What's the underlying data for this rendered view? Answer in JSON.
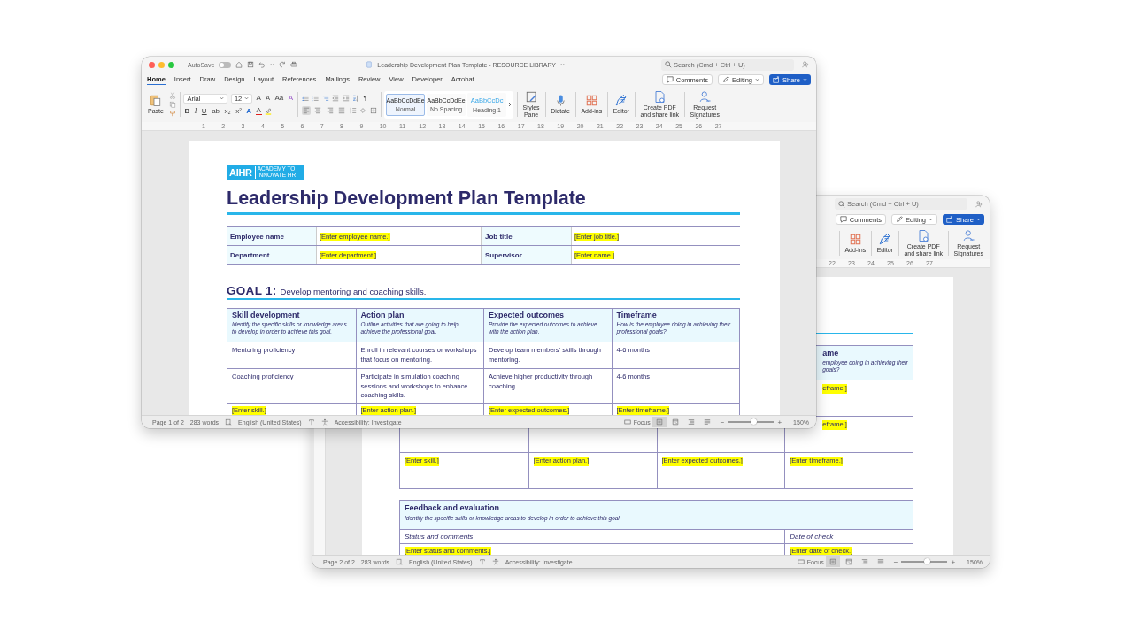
{
  "back_window": {
    "search_placeholder": "Search (Cmd + Ctrl + U)",
    "actions": {
      "comments": "Comments",
      "editing": "Editing",
      "share": "Share"
    },
    "tools": [
      {
        "label": "Add-ins",
        "kind": "addins"
      },
      {
        "label": "Editor",
        "kind": "editor"
      },
      {
        "label": "Create PDF\nand share link",
        "kind": "pdf"
      },
      {
        "label": "Request\nSignatures",
        "kind": "sign"
      }
    ],
    "ruler": [
      "22",
      "23",
      "24",
      "25",
      "26",
      "27"
    ],
    "document": {
      "table": {
        "header": {
          "title": "ame",
          "hint_lines": [
            "employee doing in achieving their",
            "goals?"
          ]
        },
        "cut_cells": [
          {
            "text": "eframe.]",
            "highlighted": true
          },
          {
            "text": "eframe.]",
            "highlighted": true
          }
        ],
        "row": [
          {
            "text": "[Enter skill.]",
            "highlighted": true
          },
          {
            "text": "[Enter action plan.]",
            "highlighted": true
          },
          {
            "text": "[Enter expected outcomes.]",
            "highlighted": true
          },
          {
            "text": "[Enter timeframe.]",
            "highlighted": true
          }
        ]
      },
      "feedback": {
        "title": "Feedback and evaluation",
        "hint": "Identify the specific skills or knowledge areas to develop in order to achieve this goal.",
        "columns": [
          "Status and comments",
          "Date of check"
        ],
        "row": [
          {
            "text": "[Enter status and comments.]",
            "highlighted": true
          },
          {
            "text": "[Enter date of check.]",
            "highlighted": true
          }
        ]
      }
    },
    "status_bar": {
      "page": "Page 2 of 2",
      "words": "283 words",
      "language": "English (United States)",
      "accessibility": "Accessibility: Investigate",
      "focus": "Focus",
      "views": [
        {
          "kind": "print",
          "selected": true
        },
        {
          "kind": "web",
          "selected": false
        },
        {
          "kind": "outline",
          "selected": false
        },
        {
          "kind": "draft",
          "selected": false
        }
      ],
      "zoom_out": "−",
      "zoom_in": "+",
      "zoom": {
        "level": 0.55
      },
      "zoom_reading": "150%"
    }
  },
  "front_window": {
    "title_bar": {
      "autosave_label": "AutoSave",
      "autosave_on": false,
      "more": "···",
      "title": "Leadership Development Plan Template - RESOURCE LIBRARY",
      "search_placeholder": "Search (Cmd + Ctrl + U)"
    },
    "tabs": [
      {
        "label": "Home",
        "selected": true
      },
      {
        "label": "Insert",
        "selected": false
      },
      {
        "label": "Draw",
        "selected": false
      },
      {
        "label": "Design",
        "selected": false
      },
      {
        "label": "Layout",
        "selected": false
      },
      {
        "label": "References",
        "selected": false
      },
      {
        "label": "Mailings",
        "selected": false
      },
      {
        "label": "Review",
        "selected": false
      },
      {
        "label": "View",
        "selected": false
      },
      {
        "label": "Developer",
        "selected": false
      },
      {
        "label": "Acrobat",
        "selected": false
      }
    ],
    "actions": {
      "comments": "Comments",
      "editing": "Editing",
      "share": "Share"
    },
    "ribbon": {
      "paste": "Paste",
      "font": "Arial",
      "size": "12",
      "font_buttons": [
        {
          "glyph": "A",
          "kind": "grow"
        },
        {
          "glyph": "A",
          "kind": "shrink"
        },
        {
          "glyph": "Aa",
          "kind": "case"
        },
        {
          "glyph": "A",
          "kind": "clear"
        }
      ],
      "format_buttons": [
        {
          "glyph": "B",
          "kind": "bold"
        },
        {
          "glyph": "I",
          "kind": "italic"
        },
        {
          "glyph": "U",
          "kind": "underline"
        },
        {
          "glyph": "ab",
          "kind": "strike"
        },
        {
          "glyph": "x₂",
          "kind": "sub"
        },
        {
          "glyph": "x²",
          "kind": "sup"
        },
        {
          "glyph": "A",
          "kind": "effects"
        },
        {
          "glyph": "A",
          "kind": "color"
        }
      ],
      "pilcrow": "¶",
      "alignments": [
        {
          "kind": "left",
          "selected": true
        },
        {
          "kind": "center",
          "selected": false
        },
        {
          "kind": "right",
          "selected": false
        },
        {
          "kind": "justify",
          "selected": false
        }
      ],
      "styles": [
        {
          "sample": "AaBbCcDdEe",
          "label": "Normal",
          "kind": "body",
          "selected": true
        },
        {
          "sample": "AaBbCcDdEe",
          "label": "No Spacing",
          "kind": "body",
          "selected": false
        },
        {
          "sample": "AaBbCcDc",
          "label": "Heading 1",
          "kind": "heading",
          "selected": false
        }
      ],
      "tools": [
        {
          "label": "Styles\nPane",
          "kind": "styles"
        },
        {
          "label": "Dictate",
          "kind": "dictate"
        },
        {
          "label": "Add-ins",
          "kind": "addins"
        },
        {
          "label": "Editor",
          "kind": "editor"
        },
        {
          "label": "Create PDF\nand share link",
          "kind": "pdf"
        },
        {
          "label": "Request\nSignatures",
          "kind": "sign"
        }
      ]
    },
    "ruler": [
      "1",
      "2",
      "3",
      "4",
      "5",
      "6",
      "7",
      "8",
      "9",
      "10",
      "11",
      "12",
      "13",
      "14",
      "15",
      "16",
      "17",
      "18",
      "19",
      "20",
      "21",
      "22",
      "23",
      "24",
      "25",
      "26",
      "27"
    ],
    "document": {
      "logo": {
        "mark": "AIHR",
        "tagline": "ACADEMY TO INNOVATE HR"
      },
      "title": "Leadership Development Plan Template",
      "info_rows": [
        [
          {
            "label": "Employee name",
            "value": "[Enter employee name.]"
          },
          {
            "label": "Job title",
            "value": "[Enter job title.]"
          }
        ],
        [
          {
            "label": "Department",
            "value": "[Enter department.]"
          },
          {
            "label": "Supervisor",
            "value": "[Enter name.]"
          }
        ]
      ],
      "goal": {
        "label": "GOAL 1:",
        "text": "Develop mentoring and coaching skills."
      },
      "table": {
        "columns": [
          {
            "title": "Skill development",
            "hint": "Identify the specific skills or knowledge areas to develop in order to achieve this goal."
          },
          {
            "title": "Action plan",
            "hint": "Outline activities that are going to help achieve the professional goal."
          },
          {
            "title": "Expected outcomes",
            "hint": "Provide the expected outcomes to achieve with the action plan."
          },
          {
            "title": "Timeframe",
            "hint": "How is the employee doing in achieving their professional goals?"
          }
        ],
        "rows": [
          [
            {
              "text": "Mentoring proficiency",
              "highlighted": false
            },
            {
              "text": "Enroll in relevant courses or workshops that focus on mentoring.",
              "highlighted": false
            },
            {
              "text": "Develop team members' skills through mentoring.",
              "highlighted": false
            },
            {
              "text": "4-6 months",
              "highlighted": false
            }
          ],
          [
            {
              "text": "Coaching proficiency",
              "highlighted": false
            },
            {
              "text": "Participate in simulation coaching sessions and workshops to enhance coaching skills.",
              "highlighted": false
            },
            {
              "text": "Achieve higher productivity through coaching.",
              "highlighted": false
            },
            {
              "text": "4-6 months",
              "highlighted": false
            }
          ],
          [
            {
              "text": "[Enter skill.]",
              "highlighted": true
            },
            {
              "text": "[Enter action plan.]",
              "highlighted": true
            },
            {
              "text": "[Enter expected outcomes.]",
              "highlighted": true
            },
            {
              "text": "[Enter timeframe.]",
              "highlighted": true
            }
          ]
        ]
      }
    },
    "status_bar": {
      "page": "Page 1 of 2",
      "words": "283 words",
      "language": "English (United States)",
      "accessibility": "Accessibility: Investigate",
      "focus": "Focus",
      "views": [
        {
          "kind": "print",
          "selected": true
        },
        {
          "kind": "web",
          "selected": false
        },
        {
          "kind": "outline",
          "selected": false
        },
        {
          "kind": "draft",
          "selected": false
        }
      ],
      "zoom_out": "−",
      "zoom_in": "+",
      "zoom": {
        "level": 0.55
      },
      "zoom_reading": "150%"
    }
  }
}
